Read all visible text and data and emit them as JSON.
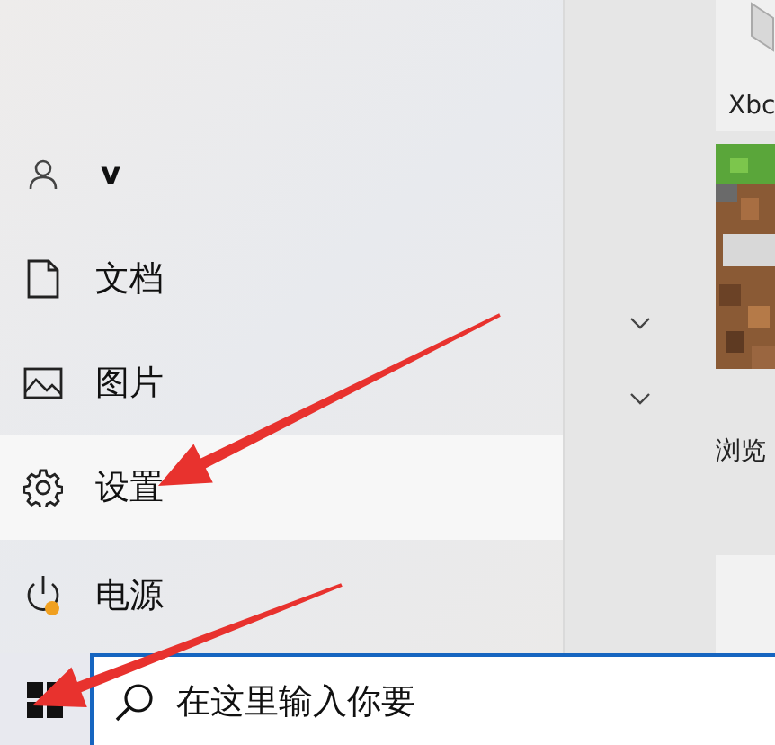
{
  "start_menu": {
    "user": {
      "name": "v"
    },
    "places": [
      {
        "kind": "documents",
        "label": "文档",
        "selected": false
      },
      {
        "kind": "pictures",
        "label": "图片",
        "selected": false
      },
      {
        "kind": "settings",
        "label": "设置",
        "selected": true
      },
      {
        "kind": "power",
        "label": "电源",
        "selected": false
      }
    ],
    "tiles": [
      {
        "kind": "app",
        "label": "Xbc"
      },
      {
        "kind": "picture"
      },
      {
        "kind": "app",
        "label": "浏览"
      }
    ]
  },
  "taskbar": {
    "search": {
      "placeholder": "在这里输入你要"
    }
  }
}
